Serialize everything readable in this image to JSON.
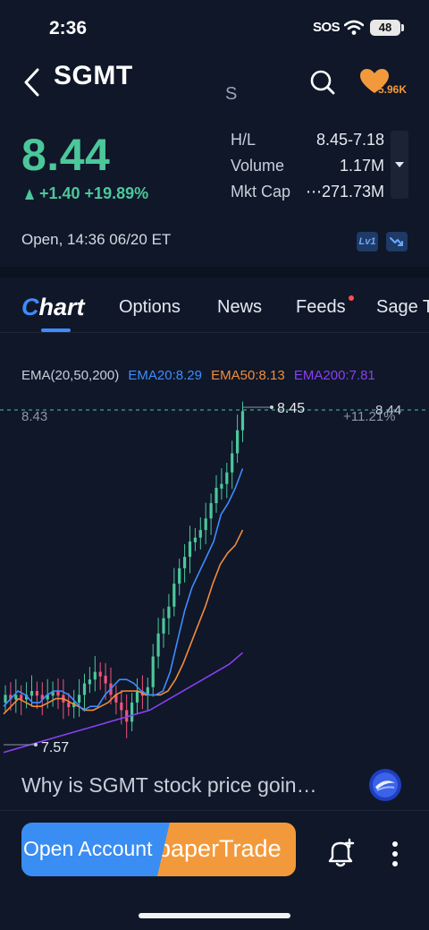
{
  "status": {
    "time": "2:36",
    "sos": "SOS",
    "battery": "48"
  },
  "header": {
    "ticker": "SGMT",
    "subtitle": "S",
    "favorites": "5.96K"
  },
  "quote": {
    "price": "8.44",
    "change": "+1.40 +19.89%",
    "stats": [
      {
        "label": "H/L",
        "value": "8.45-7.18"
      },
      {
        "label": "Volume",
        "value": "1.17M"
      },
      {
        "label": "Mkt Cap",
        "value": "⋯271.73M"
      }
    ],
    "session": "Open,  14:36 06/20 ET",
    "level_badge": "Lv1"
  },
  "tabs": {
    "chart_c": "C",
    "chart_rest": "hart",
    "items": [
      "Options",
      "News",
      "Feeds",
      "Sage T"
    ]
  },
  "ema": {
    "title": "EMA(20,50,200)",
    "ema20": "EMA20:8.29",
    "ema50": "EMA50:8.13",
    "ema200": "EMA200:7.81"
  },
  "colors": {
    "up": "#4cc79a",
    "down": "#f0557a",
    "accent": "#3e8cff",
    "ema20": "#3e8cff",
    "ema50": "#f28c38",
    "ema200": "#8a3ff0",
    "brand_orange": "#f29a3b"
  },
  "chart_data": {
    "type": "candlestick",
    "price_line": "8.43",
    "high_marker": "8.45",
    "low_marker": "7.57",
    "last_label": "8.44",
    "pct_label": "+11.21%",
    "closes": [
      7.7,
      7.69,
      7.7,
      7.69,
      7.7,
      7.71,
      7.7,
      7.69,
      7.7,
      7.71,
      7.7,
      7.68,
      7.67,
      7.68,
      7.7,
      7.73,
      7.74,
      7.76,
      7.75,
      7.73,
      7.7,
      7.68,
      7.66,
      7.63,
      7.68,
      7.71,
      7.7,
      7.72,
      7.8,
      7.86,
      7.9,
      7.93,
      7.99,
      8.03,
      8.06,
      8.1,
      8.11,
      8.13,
      8.16,
      8.2,
      8.24,
      8.25,
      8.28,
      8.33,
      8.39,
      8.44
    ],
    "ema20": [
      7.67,
      7.69,
      7.71,
      7.7,
      7.68,
      7.68,
      7.7,
      7.71,
      7.71,
      7.7,
      7.68,
      7.66,
      7.67,
      7.67,
      7.7,
      7.72,
      7.74,
      7.74,
      7.73,
      7.71,
      7.7,
      7.7,
      7.71,
      7.76,
      7.84,
      7.92,
      7.98,
      8.02,
      8.06,
      8.1,
      8.17,
      8.2,
      8.24,
      8.29
    ],
    "ema50": [
      7.65,
      7.67,
      7.69,
      7.68,
      7.67,
      7.67,
      7.68,
      7.69,
      7.69,
      7.68,
      7.67,
      7.66,
      7.66,
      7.67,
      7.68,
      7.7,
      7.71,
      7.71,
      7.71,
      7.7,
      7.7,
      7.7,
      7.71,
      7.74,
      7.78,
      7.83,
      7.88,
      7.93,
      7.99,
      8.04,
      8.07,
      8.09,
      8.13
    ],
    "ema200": [
      7.55,
      7.56,
      7.57,
      7.58,
      7.59,
      7.6,
      7.61,
      7.62,
      7.63,
      7.64,
      7.65,
      7.66,
      7.68,
      7.7,
      7.72,
      7.74,
      7.76,
      7.78,
      7.81
    ]
  },
  "ask": {
    "text": "Why is SGMT stock price goin…"
  },
  "actions": {
    "open_account": "Open Account",
    "paper_trade": "paperTrade"
  }
}
